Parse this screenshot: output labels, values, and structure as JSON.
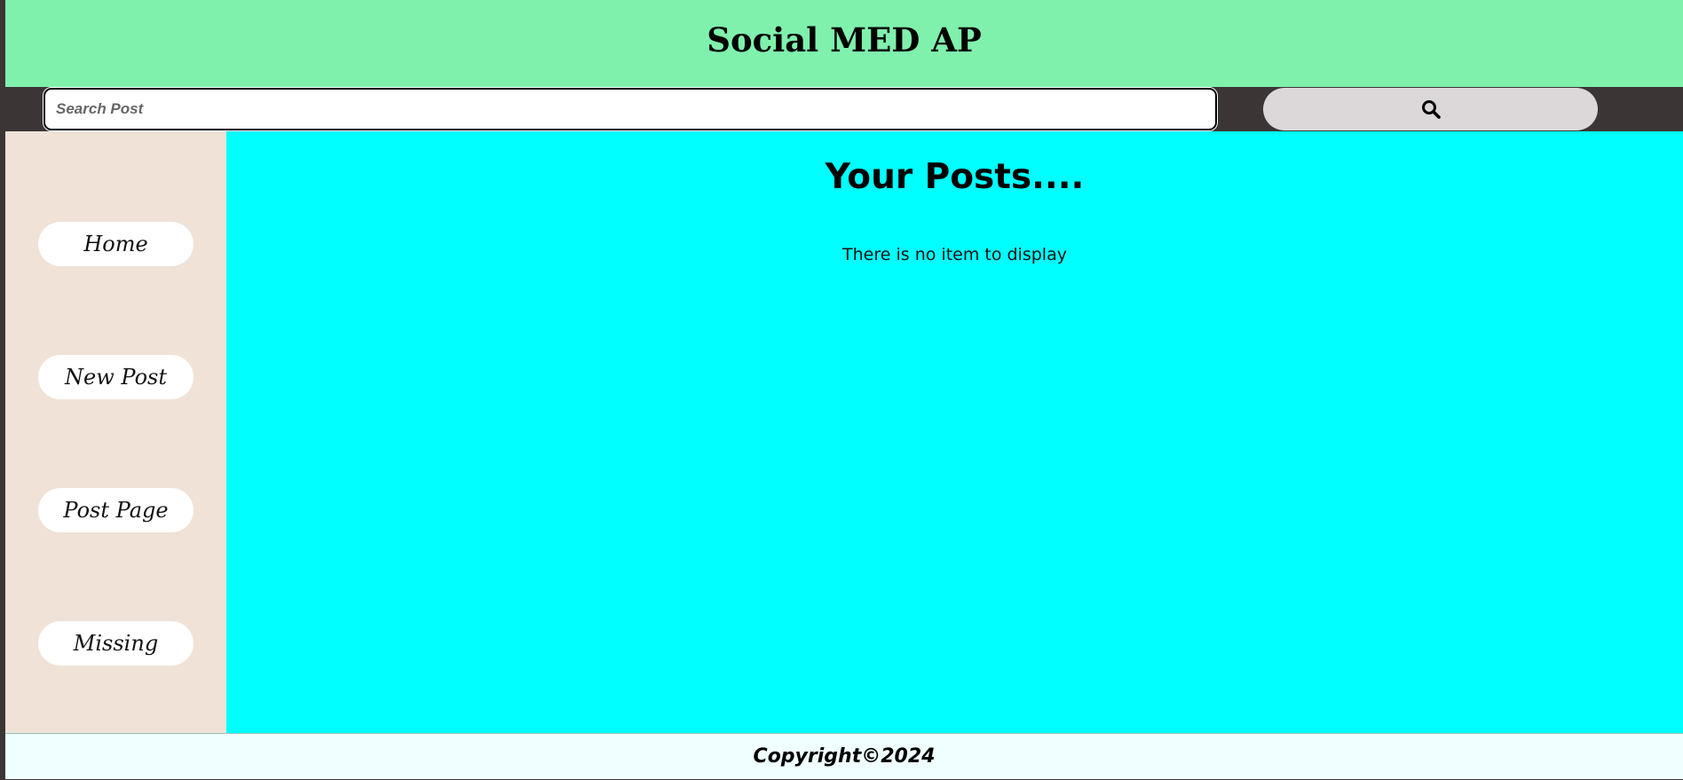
{
  "header": {
    "title": "Social MED AP"
  },
  "search": {
    "placeholder": "Search Post",
    "button_icon": "search-icon"
  },
  "sidebar": {
    "items": [
      {
        "label": "Home"
      },
      {
        "label": "New Post"
      },
      {
        "label": "Post Page"
      },
      {
        "label": "Missing"
      }
    ]
  },
  "main": {
    "heading": "Your Posts....",
    "empty_message": "There is no item to display"
  },
  "footer": {
    "copyright": "Copyright©2024"
  },
  "colors": {
    "header_bg": "#7ff1ad",
    "search_bar_bg": "#3b3536",
    "sidebar_bg": "#f0e2d7",
    "main_bg": "#00ffff",
    "footer_bg": "#f0ffff"
  }
}
